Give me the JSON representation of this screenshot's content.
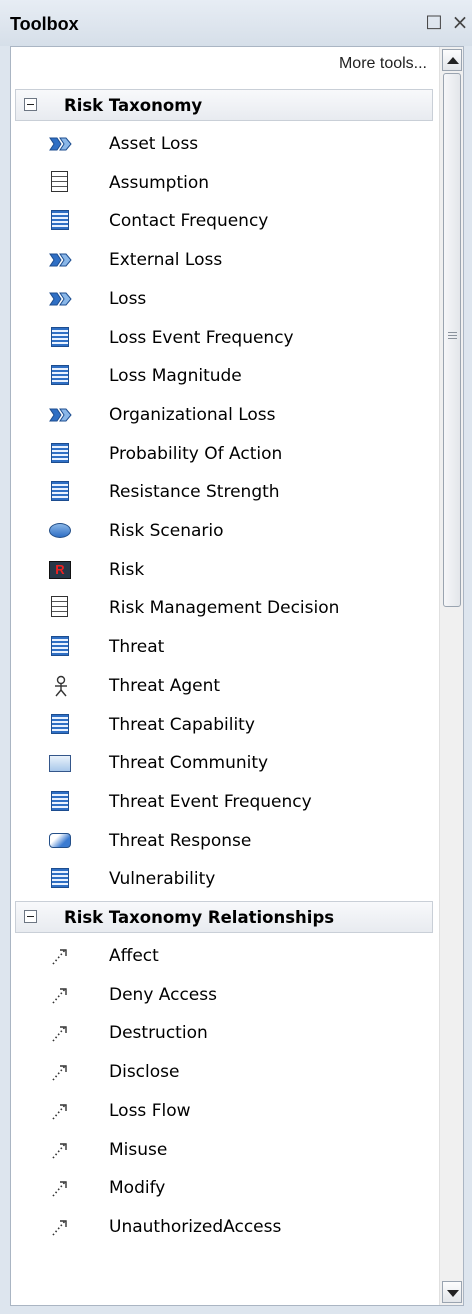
{
  "window": {
    "title": "Toolbox",
    "maximize_glyph": "□",
    "close_glyph": "×"
  },
  "toolbar": {
    "more_tools_label": "More tools..."
  },
  "categories": [
    {
      "label": "Risk Taxonomy",
      "items": [
        {
          "label": "Asset Loss",
          "icon": "flow-arrows-icon"
        },
        {
          "label": "Assumption",
          "icon": "document-icon"
        },
        {
          "label": "Contact Frequency",
          "icon": "block-icon"
        },
        {
          "label": "External Loss",
          "icon": "flow-arrows-icon"
        },
        {
          "label": "Loss",
          "icon": "flow-arrows-icon"
        },
        {
          "label": "Loss Event Frequency",
          "icon": "block-icon"
        },
        {
          "label": "Loss Magnitude",
          "icon": "block-icon"
        },
        {
          "label": "Organizational Loss",
          "icon": "flow-arrows-icon"
        },
        {
          "label": "Probability Of Action",
          "icon": "block-icon"
        },
        {
          "label": "Resistance Strength",
          "icon": "block-icon"
        },
        {
          "label": "Risk Scenario",
          "icon": "ellipse-icon"
        },
        {
          "label": "Risk",
          "icon": "risk-icon",
          "icon_text": "R"
        },
        {
          "label": "Risk Management Decision",
          "icon": "document-icon"
        },
        {
          "label": "Threat",
          "icon": "block-icon"
        },
        {
          "label": "Threat Agent",
          "icon": "actor-icon"
        },
        {
          "label": "Threat Capability",
          "icon": "block-icon"
        },
        {
          "label": "Threat Community",
          "icon": "folder-icon"
        },
        {
          "label": "Threat Event Frequency",
          "icon": "block-icon"
        },
        {
          "label": "Threat Response",
          "icon": "rounded-rect-icon"
        },
        {
          "label": "Vulnerability",
          "icon": "block-icon"
        }
      ]
    },
    {
      "label": "Risk Taxonomy Relationships",
      "items": [
        {
          "label": "Affect",
          "icon": "dotted-connector-icon"
        },
        {
          "label": "Deny Access",
          "icon": "dotted-connector-icon"
        },
        {
          "label": "Destruction",
          "icon": "dotted-connector-icon"
        },
        {
          "label": "Disclose",
          "icon": "dotted-connector-icon"
        },
        {
          "label": "Loss Flow",
          "icon": "dotted-connector-icon"
        },
        {
          "label": "Misuse",
          "icon": "dotted-connector-icon"
        },
        {
          "label": "Modify",
          "icon": "dotted-connector-icon"
        },
        {
          "label": "UnauthorizedAccess",
          "icon": "dotted-connector-icon"
        }
      ]
    }
  ],
  "colors": {
    "title_bar": "#dfe6ee",
    "category_header": "#eceff3",
    "icon_blue": "#2f6fc4"
  }
}
